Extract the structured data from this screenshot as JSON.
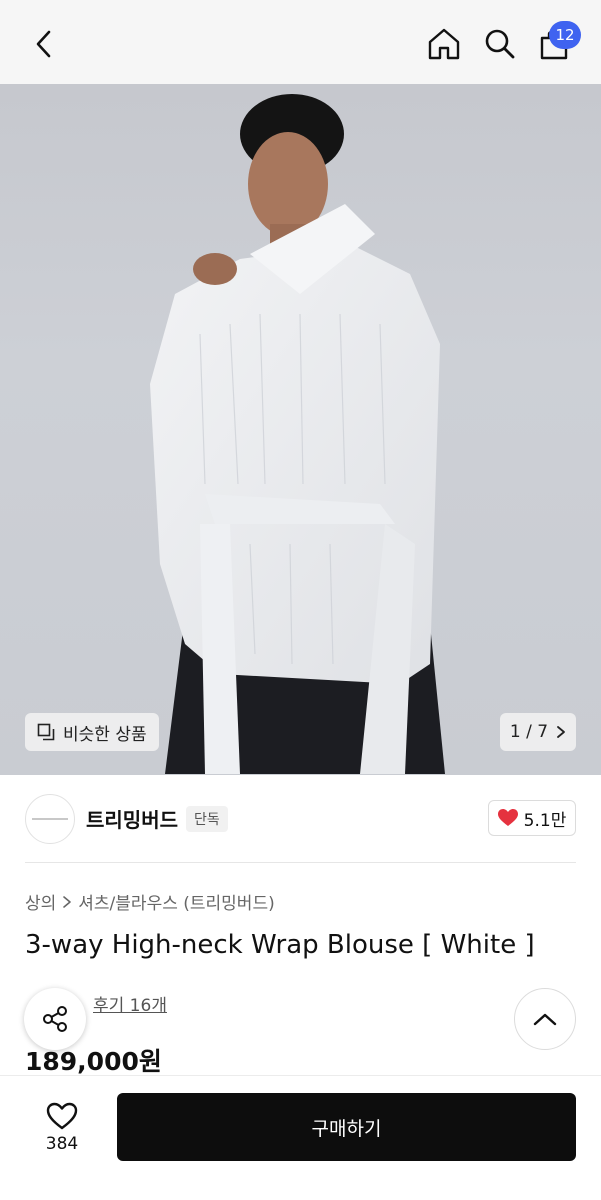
{
  "header": {
    "cart_count": "12",
    "icons": [
      "back-arrow-icon",
      "home-icon",
      "search-icon",
      "shopping-bag-icon"
    ]
  },
  "gallery": {
    "similar_label": "비슷한 상품",
    "pager": "1 / 7"
  },
  "brand": {
    "name": "트리밍버드",
    "tag": "단독",
    "likes": "5.1만"
  },
  "product": {
    "breadcrumb_category": "상의",
    "breadcrumb_sub": "셔츠/블라우스 (트리밍버드)",
    "title": "3-way High-neck Wrap Blouse [ White ]",
    "review_link": "후기 16개",
    "price": "189,000원"
  },
  "bottom": {
    "wish_count": "384",
    "buy_label": "구매하기"
  },
  "colors": {
    "accent_badge": "#3f63f0",
    "heart": "#e5323f",
    "buy_button": "#0d0d0d"
  }
}
